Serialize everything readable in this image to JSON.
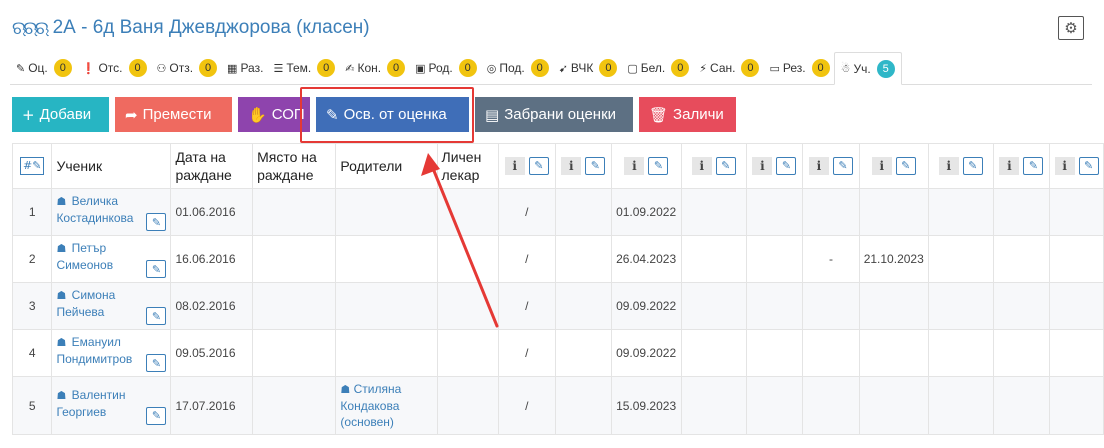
{
  "header": {
    "title": "2А - 6д Ваня Джевджорова (класен)",
    "group_icon": "ଋଋଋ",
    "gear_icon": "⚙"
  },
  "tabs": [
    {
      "icon": "✎",
      "label": "Оц.",
      "badge": "0"
    },
    {
      "icon": "❗",
      "label": "Отс.",
      "badge": "0"
    },
    {
      "icon": "⚇",
      "label": "Отз.",
      "badge": "0"
    },
    {
      "icon": "▦",
      "label": "Раз.",
      "badge": ""
    },
    {
      "icon": "☰",
      "label": "Тем.",
      "badge": "0"
    },
    {
      "icon": "✍",
      "label": "Кон.",
      "badge": "0"
    },
    {
      "icon": "▣",
      "label": "Род.",
      "badge": "0"
    },
    {
      "icon": "◎",
      "label": "Под.",
      "badge": "0"
    },
    {
      "icon": "➹",
      "label": "ВЧК",
      "badge": "0"
    },
    {
      "icon": "▢",
      "label": "Бел.",
      "badge": "0"
    },
    {
      "icon": "⚡",
      "label": "Сан.",
      "badge": "0"
    },
    {
      "icon": "▭",
      "label": "Рез.",
      "badge": "0"
    },
    {
      "icon": "☃",
      "label": "Уч.",
      "badge": "5"
    }
  ],
  "toolbar": {
    "add": {
      "icon": "+",
      "label": "Добави"
    },
    "move": {
      "icon": "➦",
      "label": "Премести"
    },
    "sop": {
      "icon": "✋",
      "label": "СОП"
    },
    "exempt": {
      "icon": "✎",
      "label": "Осв. от оценка"
    },
    "forbid": {
      "icon": "▤",
      "label": "Забрани оценки"
    },
    "delete": {
      "icon": "🗑",
      "label": "Заличи"
    }
  },
  "table": {
    "hash": "#",
    "edit_icon": "✎",
    "info_icon": "i",
    "headers": {
      "student": "Ученик",
      "birth_date": "Дата на раждане",
      "birth_place": "Място на раждане",
      "parents": "Родители",
      "doctor": "Личен лекар"
    },
    "rows": [
      {
        "num": "1",
        "name": "Величка Костадинкова",
        "birth_date": "01.06.2016",
        "parents": "",
        "c1": "/",
        "c3": "01.09.2022",
        "c6": "",
        "c7": ""
      },
      {
        "num": "2",
        "name": "Петър Симеонов",
        "birth_date": "16.06.2016",
        "parents": "",
        "c1": "/",
        "c3": "26.04.2023",
        "c6": "-",
        "c7": "21.10.2023"
      },
      {
        "num": "3",
        "name": "Симона Пейчева",
        "birth_date": "08.02.2016",
        "parents": "",
        "c1": "/",
        "c3": "09.09.2022",
        "c6": "",
        "c7": ""
      },
      {
        "num": "4",
        "name": "Емануил Пондимитров",
        "birth_date": "09.05.2016",
        "parents": "",
        "c1": "/",
        "c3": "09.09.2022",
        "c6": "",
        "c7": ""
      },
      {
        "num": "5",
        "name": "Валентин Георгиев",
        "birth_date": "17.07.2016",
        "parents": "Стиляна Кондакова (основен)",
        "c1": "/",
        "c3": "15.09.2023",
        "c6": "",
        "c7": ""
      }
    ]
  },
  "colors": {
    "link": "#3c7fb8",
    "highlight": "#e53935"
  }
}
